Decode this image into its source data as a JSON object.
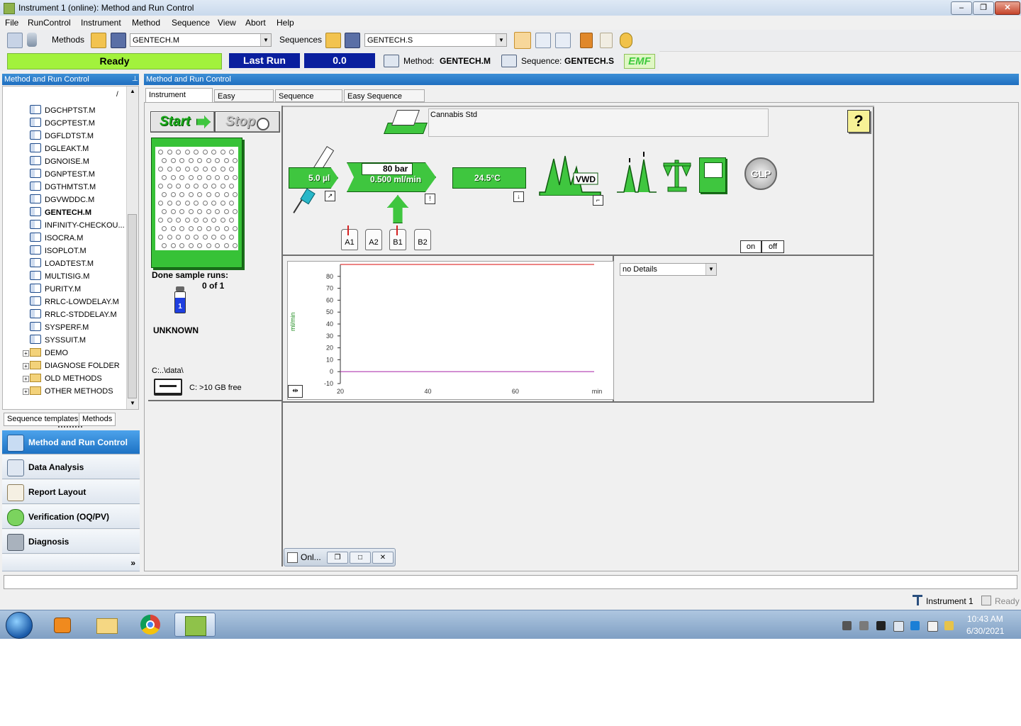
{
  "window": {
    "title": "Instrument 1 (online): Method and Run Control",
    "controls": {
      "minimize": "–",
      "maximize": "❐",
      "close": "✕"
    }
  },
  "menu": [
    "File",
    "RunControl",
    "Instrument",
    "Method",
    "Sequence",
    "View",
    "Abort",
    "Help"
  ],
  "toolbar": {
    "methods_label": "Methods",
    "method_value": "GENTECH.M",
    "sequences_label": "Sequences",
    "sequence_value": "GENTECH.S"
  },
  "status": {
    "state": "Ready",
    "last_run_label": "Last Run",
    "last_run_value": "0.0",
    "method_label": "Method:",
    "method_value": "GENTECH.M",
    "sequence_label": "Sequence:",
    "sequence_value": "GENTECH.S",
    "emf": "EMF"
  },
  "left_panel": {
    "header": "Method and Run Control",
    "path_hint": "/",
    "methods": [
      "DGCHPTST.M",
      "DGCPTEST.M",
      "DGFLDTST.M",
      "DGLEAKT.M",
      "DGNOISE.M",
      "DGNPTEST.M",
      "DGTHMTST.M",
      "DGVWDDC.M",
      "GENTECH.M",
      "INFINITY-CHECKOU...",
      "ISOCRA.M",
      "ISOPLOT.M",
      "LOADTEST.M",
      "MULTISIG.M",
      "PURITY.M",
      "RRLC-LOWDELAY.M",
      "RRLC-STDDELAY.M",
      "SYSPERF.M",
      "SYSSUIT.M"
    ],
    "folders": [
      "DEMO",
      "DIAGNOSE FOLDER",
      "OLD METHODS",
      "OTHER METHODS"
    ],
    "tabs": [
      "Sequence templates",
      "Methods"
    ],
    "nav": [
      "Method and Run Control",
      "Data Analysis",
      "Report Layout",
      "Verification (OQ/PV)",
      "Diagnosis"
    ],
    "more": "»"
  },
  "main_panel": {
    "header": "Method and Run Control",
    "tabs": [
      "Instrument Control",
      "Easy Sequence",
      "Sequence Queue",
      "Easy Sequence Setup"
    ],
    "start_label": "Start",
    "stop_label": "Stop",
    "done_runs_label": "Done sample runs:",
    "done_runs_value": "0 of 1",
    "sample_name": "UNKNOWN",
    "vial_number": "1",
    "data_path": "C:..\\data\\",
    "disk_free": "C: >10 GB free",
    "method_comment": "Cannabis Std",
    "help": "?",
    "injector_volume": "5.0 µl",
    "pump_pressure": "80 bar",
    "pump_flow": "0.500 ml/min",
    "column_temp": "24.5°C",
    "detector": "VWD",
    "glp": "GLP",
    "bottles": [
      "A1",
      "A2",
      "B1",
      "B2"
    ],
    "on_label": "on",
    "off_label": "off",
    "details_select": "no Details",
    "online_window": "Onl..."
  },
  "chart_data": {
    "type": "line",
    "ylabel": "ml/min",
    "xlabel": "min",
    "x_ticks": [
      20,
      40,
      60
    ],
    "y_ticks": [
      80,
      70,
      60,
      50,
      40,
      30,
      20,
      10,
      0,
      -10
    ],
    "ylim": [
      -10,
      90
    ],
    "xlim": [
      20,
      78
    ],
    "series": [
      {
        "color": "#e03a3a",
        "x": [
          20,
          78
        ],
        "values": [
          90,
          90
        ]
      },
      {
        "color": "#b03ab0",
        "x": [
          20,
          78
        ],
        "values": [
          0,
          0
        ]
      }
    ]
  },
  "statusbar_bottom": {
    "instrument": "Instrument 1",
    "state": "Ready"
  },
  "taskbar": {
    "time": "10:43 AM",
    "date": "6/30/2021"
  }
}
